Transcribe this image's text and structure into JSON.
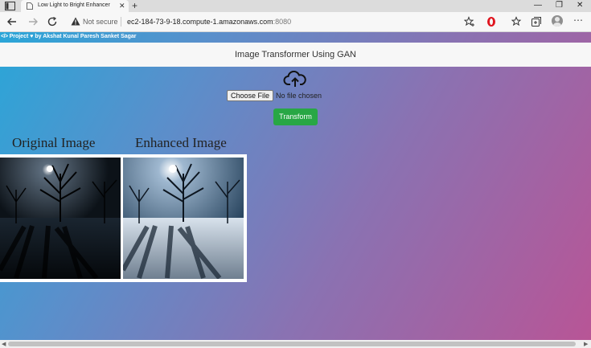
{
  "browser": {
    "tab_title": "Low Light to Bright Enhancer",
    "close_tab": "✕",
    "new_tab": "+",
    "window_buttons": {
      "minimize": "—",
      "maximize": "❐",
      "close": "✕"
    },
    "not_secure": "Not secure",
    "url_host": "ec2-184-73-9-18.compute-1.amazonaws.com",
    "url_port": ":8080",
    "more": "⋯"
  },
  "page": {
    "credit_code": "</>",
    "credit_text": " Project ",
    "credit_heart": "♥",
    "credit_by": " by Akshat Kunal Paresh Sanket Sagar",
    "header_title": "Image Transformer Using GAN",
    "choose_file_button": "Choose File",
    "no_file_text": "No file chosen",
    "transform_button": "Transform",
    "original_label": "Original Image",
    "enhanced_label": "Enhanced Image"
  },
  "colors": {
    "transform_button": "#28a745",
    "gradient_start": "#2aa6d8",
    "gradient_end": "#b85596",
    "header_bg": "#f7f7f7"
  },
  "icons": [
    "sidebar-toggle-icon",
    "page-icon",
    "back-icon",
    "forward-icon",
    "refresh-icon",
    "warning-icon",
    "favorites-add-icon",
    "opera-icon",
    "favorites-icon",
    "collections-icon",
    "profile-icon",
    "more-icon",
    "upload-cloud-icon"
  ]
}
